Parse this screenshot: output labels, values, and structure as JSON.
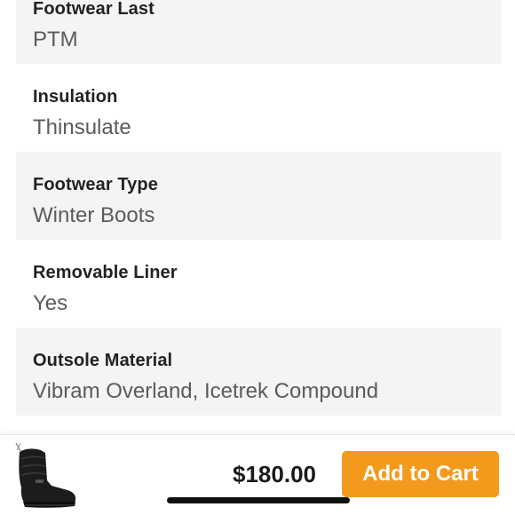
{
  "specs": [
    {
      "label": "Footwear Last",
      "value": "PTM"
    },
    {
      "label": "Insulation",
      "value": "Thinsulate"
    },
    {
      "label": "Footwear Type",
      "value": "Winter Boots"
    },
    {
      "label": "Removable Liner",
      "value": "Yes"
    },
    {
      "label": "Outsole Material",
      "value": "Vibram Overland, Icetrek Compound"
    }
  ],
  "purchase_bar": {
    "price": "$180.00",
    "add_to_cart_label": "Add to Cart",
    "product_image_icon": "winter-boot-icon",
    "button_color": "#f39a1d"
  },
  "colors": {
    "row_shade": "#f4f4f4",
    "label_text": "#222222",
    "value_text": "#5b5b5b"
  }
}
